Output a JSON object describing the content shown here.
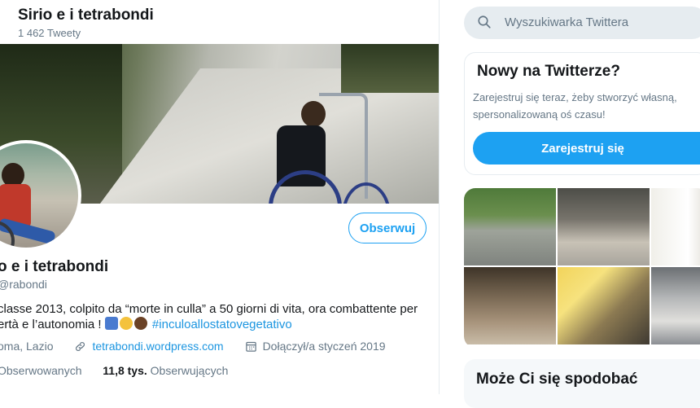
{
  "header": {
    "name": "Sirio e i tetrabondi",
    "tweet_count": "1 462 Tweety"
  },
  "profile": {
    "display_name": "o e i tetrabondi",
    "handle": "rabondi",
    "follow_label": "Obserwuj",
    "bio_line1": "classe 2013, colpito da “morte in culla” a 50 giorni di vita, ora combattente per",
    "bio_line2_text": "ertà e l’autonomia !",
    "bio_hashtag": "#inculoallostatovegetativo",
    "location": "oma, Lazio",
    "website": "tetrabondi.wordpress.com",
    "joined": "Dołączył/a styczeń 2019",
    "following_label": "Obserwowanych",
    "followers_count": "11,8 tys.",
    "followers_label": "Obserwujących"
  },
  "sidebar": {
    "search_placeholder": "Wyszukiwarka Twittera",
    "new_title": "Nowy na Twitterze?",
    "new_text": "Zarejestruj się teraz, żeby stworzyć własną, spersonalizowaną oś czasu!",
    "signup_label": "Zarejestruj się",
    "suggest_title": "Może Ci się spodobać"
  },
  "colors": {
    "accent": "#1da1f2",
    "link": "#1b95e0",
    "secondary_text": "#657786"
  }
}
